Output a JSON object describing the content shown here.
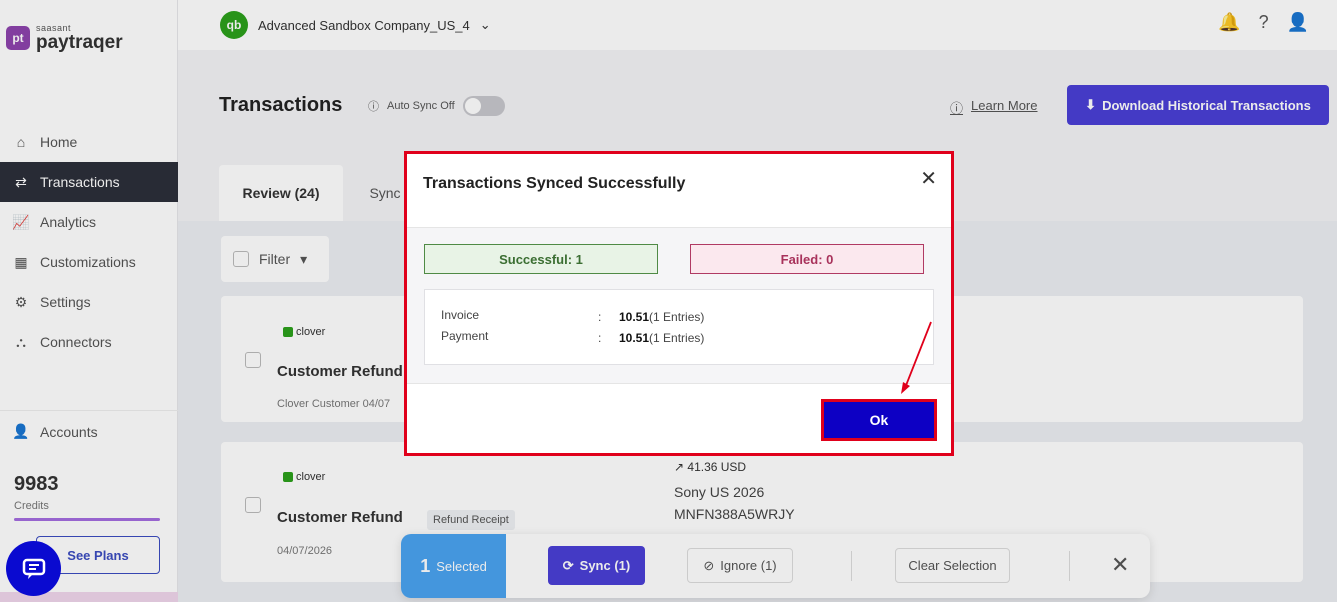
{
  "brand": {
    "logo_mark": "pt",
    "small": "saasant",
    "name": "paytraqer"
  },
  "company": {
    "name": "Advanced Sandbox Company_US_4",
    "chevron": "⌄"
  },
  "sidebar": {
    "items": [
      {
        "label": "Home",
        "icon": "home-icon",
        "glyph": "⌂"
      },
      {
        "label": "Transactions",
        "icon": "transfer-icon",
        "glyph": "⇄"
      },
      {
        "label": "Analytics",
        "icon": "chart-icon",
        "glyph": "📈"
      },
      {
        "label": "Customizations",
        "icon": "grid-icon",
        "glyph": "▦"
      },
      {
        "label": "Settings",
        "icon": "gear-icon",
        "glyph": "⚙"
      },
      {
        "label": "Connectors",
        "icon": "plug-icon",
        "glyph": "⛬"
      }
    ],
    "accounts": {
      "label": "Accounts",
      "glyph": "👤"
    },
    "credits": {
      "value": "9983",
      "label": "Credits"
    },
    "see_plans": "See Plans"
  },
  "page": {
    "title": "Transactions",
    "auto_sync": "Auto Sync Off",
    "learn_more": "Learn More",
    "download": "Download Historical Transactions"
  },
  "tabs": {
    "review": "Review (24)",
    "synced": "Sync"
  },
  "filter": "Filter",
  "cards": [
    {
      "source": "clover",
      "type": "Customer Refund",
      "sub": "Clover Customer  04/07"
    },
    {
      "source": "clover",
      "type": "Customer Refund",
      "badge": "Refund Receipt",
      "date": "04/07/2026",
      "amount": "↗  41.36 USD",
      "desc": "Sony US 2026",
      "ref": "MNFN388A5WRJY"
    }
  ],
  "bulk": {
    "count": "1",
    "count_label": "Selected",
    "sync": "Sync (1)",
    "ignore": "Ignore (1)",
    "clear": "Clear Selection",
    "close": "✕"
  },
  "modal": {
    "title": "Transactions Synced Successfully",
    "close": "✕",
    "successful": "Successful: 1",
    "failed": "Failed: 0",
    "rows": [
      {
        "label": "Invoice",
        "colon": ":",
        "value": "10.51",
        "suffix": "(1 Entries)"
      },
      {
        "label": "Payment",
        "colon": ":",
        "value": "10.51",
        "suffix": "(1 Entries)"
      }
    ],
    "ok": "Ok"
  },
  "colors": {
    "accent": "#4a3fd6",
    "highlight": "#e0001b",
    "ok_button": "#0d00c4"
  }
}
